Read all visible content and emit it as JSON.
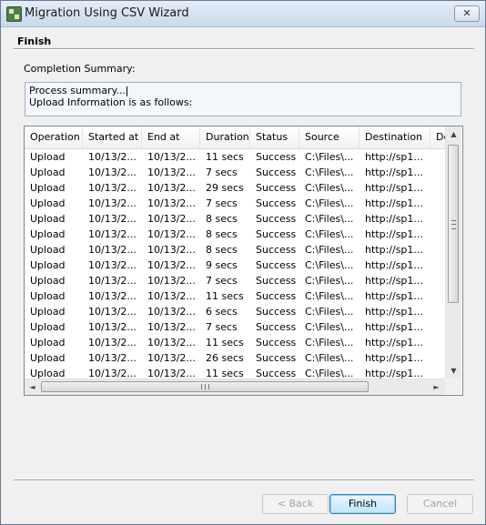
{
  "window": {
    "title": "Migration Using CSV Wizard",
    "close_glyph": "✕"
  },
  "page": {
    "section_title": "Finish",
    "summary_label": "Completion Summary:"
  },
  "summary_box": {
    "lines": [
      "Process summary...",
      "Upload Information is as follows:"
    ]
  },
  "table": {
    "columns": [
      "Operation",
      "Started at",
      "End at",
      "Duration",
      "Status",
      "Source",
      "Destination",
      "De"
    ],
    "rows": [
      [
        "Upload",
        "10/13/2...",
        "10/13/2...",
        "11 secs",
        "Success",
        "C:\\Files\\...",
        "http://sp1..."
      ],
      [
        "Upload",
        "10/13/2...",
        "10/13/2...",
        "7 secs",
        "Success",
        "C:\\Files\\...",
        "http://sp1..."
      ],
      [
        "Upload",
        "10/13/2...",
        "10/13/2...",
        "29 secs",
        "Success",
        "C:\\Files\\...",
        "http://sp1..."
      ],
      [
        "Upload",
        "10/13/2...",
        "10/13/2...",
        "7 secs",
        "Success",
        "C:\\Files\\...",
        "http://sp1..."
      ],
      [
        "Upload",
        "10/13/2...",
        "10/13/2...",
        "8 secs",
        "Success",
        "C:\\Files\\...",
        "http://sp1..."
      ],
      [
        "Upload",
        "10/13/2...",
        "10/13/2...",
        "8 secs",
        "Success",
        "C:\\Files\\...",
        "http://sp1..."
      ],
      [
        "Upload",
        "10/13/2...",
        "10/13/2...",
        "8 secs",
        "Success",
        "C:\\Files\\...",
        "http://sp1..."
      ],
      [
        "Upload",
        "10/13/2...",
        "10/13/2...",
        "9 secs",
        "Success",
        "C:\\Files\\...",
        "http://sp1..."
      ],
      [
        "Upload",
        "10/13/2...",
        "10/13/2...",
        "7 secs",
        "Success",
        "C:\\Files\\...",
        "http://sp1..."
      ],
      [
        "Upload",
        "10/13/2...",
        "10/13/2...",
        "11 secs",
        "Success",
        "C:\\Files\\...",
        "http://sp1..."
      ],
      [
        "Upload",
        "10/13/2...",
        "10/13/2...",
        "6 secs",
        "Success",
        "C:\\Files\\...",
        "http://sp1..."
      ],
      [
        "Upload",
        "10/13/2...",
        "10/13/2...",
        "7 secs",
        "Success",
        "C:\\Files\\...",
        "http://sp1..."
      ],
      [
        "Upload",
        "10/13/2...",
        "10/13/2...",
        "11 secs",
        "Success",
        "C:\\Files\\...",
        "http://sp1..."
      ],
      [
        "Upload",
        "10/13/2...",
        "10/13/2...",
        "26 secs",
        "Success",
        "C:\\Files\\...",
        "http://sp1..."
      ],
      [
        "Upload",
        "10/13/2...",
        "10/13/2...",
        "11 secs",
        "Success",
        "C:\\Files\\...",
        "http://sp1..."
      ]
    ]
  },
  "scrollbars": {
    "up_glyph": "▲",
    "down_glyph": "▼",
    "left_glyph": "◄",
    "right_glyph": "►",
    "hgrip_glyph": "III",
    "vgrip_glyph": "≡"
  },
  "buttons": {
    "back": "< Back",
    "finish": "Finish",
    "cancel": "Cancel"
  }
}
